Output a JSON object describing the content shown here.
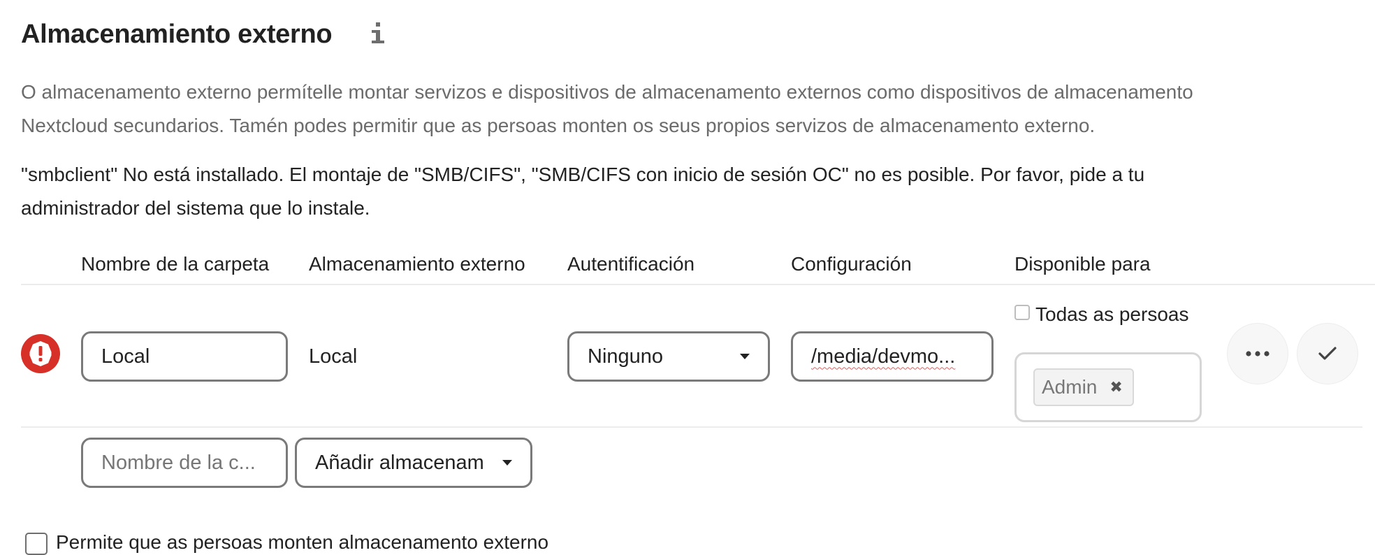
{
  "section": {
    "title": "Almacenamiento externo",
    "info_icon": "info-icon",
    "description_line1": "O almacenamento externo permítelle montar servizos e dispositivos de almacenamento externos como dispositivos de almacenamento",
    "description_line2": "Nextcloud secundarios. Tamén podes permitir que as persoas monten os seus propios servizos de almacenamento externo.",
    "warning_line1": "\"smbclient\" No está installado. El montaje de \"SMB/CIFS\", \"SMB/CIFS con inicio de sesión OC\" no es posible. Por favor, pide a tu",
    "warning_line2": "administrador del sistema que lo instale."
  },
  "table": {
    "headers": {
      "folder_name": "Nombre de la carpeta",
      "external_storage": "Almacenamiento externo",
      "authentication": "Autentificación",
      "configuration": "Configuración",
      "available_for": "Disponible para"
    },
    "row": {
      "status_icon": "error-icon",
      "status_color": "#e9322d",
      "folder_name_value": "Local",
      "storage_type": "Local",
      "authentication_value": "Ninguno",
      "configuration_value": "/media/devmo...",
      "all_users_label": "Todas as persoas",
      "all_users_checked": false,
      "applicable_tags": [
        "Admin"
      ],
      "more_icon": "more-icon",
      "save_icon": "checkmark-icon"
    },
    "new_row": {
      "folder_name_placeholder": "Nombre de la c...",
      "add_storage_label": "Añadir almacenam"
    }
  },
  "allow_user_mounting": {
    "label": "Permite que as persoas monten almacenamento externo",
    "checked": false
  }
}
